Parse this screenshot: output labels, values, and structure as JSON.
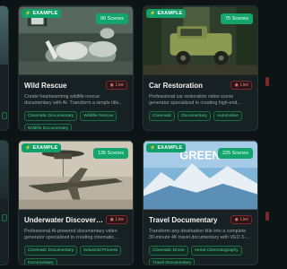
{
  "cards": [
    {
      "example_label": "EXAMPLE",
      "scenes": "90 Scenes",
      "title": "Wild Rescue",
      "live": "Live",
      "description": "Create heartwarming wildlife rescue documentary with AI. Transform a simple title...",
      "tags": [
        "Cinematic Documentary",
        "Wildlife Rescue",
        "Wildlife Documentary"
      ]
    },
    {
      "example_label": "EXAMPLE",
      "scenes": "75 Scenes",
      "title": "Car Restoration",
      "live": "Live",
      "description": "Professional car restoration video scene generator specialized in creating high-end...",
      "tags": [
        "Cinematic",
        "Documentary",
        "Automotive"
      ]
    },
    {
      "example_label": "EXAMPLE",
      "scenes": "135 Scenes",
      "title": "Underwater Discovery & ...",
      "live": "Live",
      "description": "Professional AI-powered documentary video generator specialized in creating cinematic...",
      "tags": [
        "Cinematic Documentary",
        "Industrial Process",
        "Documentary"
      ]
    },
    {
      "example_label": "EXAMPLE",
      "scenes": "225 Scenes",
      "title": "Travel Documentary",
      "live": "Live",
      "description": "Transform any destination title into a complete 30-minute 4K travel documentary with VEO 3-...",
      "tags": [
        "Cinematic Drone",
        "Aerial Cinematography",
        "Travel Documentary"
      ],
      "thumb_text": "GREEN"
    }
  ],
  "colors": {
    "accent": "#12a06a",
    "live": "#f08080",
    "tag": "#4fd39a",
    "background": "#0d1416",
    "card": "#172022"
  }
}
